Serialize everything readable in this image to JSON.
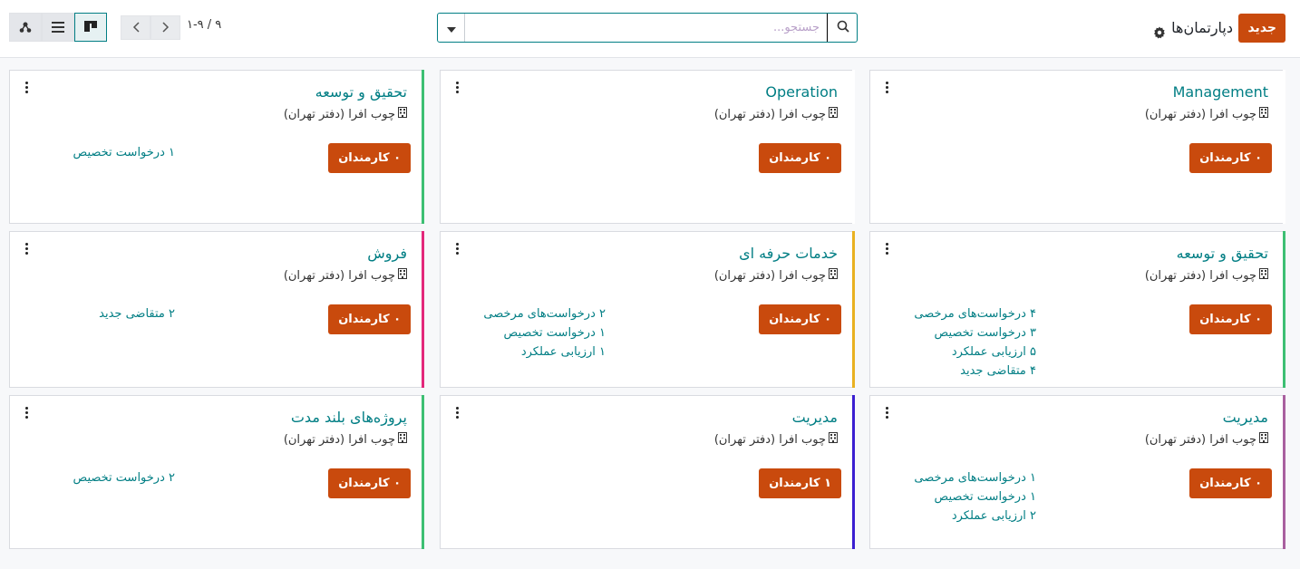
{
  "header": {
    "new_label": "جدید",
    "title": "دپارتمان‌ها",
    "gear_icon": "gear-icon",
    "search_placeholder": "جستجو...",
    "pager": "۱-۹ / ۹"
  },
  "colors": {
    "accent": "#c94a0d",
    "link": "#017e84"
  },
  "cards": [
    {
      "title": "Management",
      "company": "چوب افرا (دفتر تهران)",
      "employees": "۰ کارمندان",
      "stats": [],
      "color": "#ffffff"
    },
    {
      "title": "Operation",
      "company": "چوب افرا (دفتر تهران)",
      "employees": "۰ کارمندان",
      "stats": [],
      "color": "#ffffff"
    },
    {
      "title": "تحقیق و توسعه",
      "company": "چوب افرا (دفتر تهران)",
      "employees": "۰ کارمندان",
      "stats": [
        "۱ درخواست تخصیص"
      ],
      "color": "#3dbf73"
    },
    {
      "title": "تحقیق و توسعه",
      "company": "چوب افرا (دفتر تهران)",
      "employees": "۰ کارمندان",
      "stats": [
        "۴ درخواست‌های مرخصی",
        "۳ درخواست تخصیص",
        "۵ ارزیابی عملکرد",
        "۴ متقاضی جدید"
      ],
      "color": "#3dbf73"
    },
    {
      "title": "خدمات حرفه ای",
      "company": "چوب افرا (دفتر تهران)",
      "employees": "۰ کارمندان",
      "stats": [
        "۲ درخواست‌های مرخصی",
        "۱ درخواست تخصیص",
        "۱ ارزیابی عملکرد"
      ],
      "color": "#e9b121"
    },
    {
      "title": "فروش",
      "company": "چوب افرا (دفتر تهران)",
      "employees": "۰ کارمندان",
      "stats": [
        "۲ متقاضی جدید"
      ],
      "color": "#e3287b"
    },
    {
      "title": "مدیریت",
      "company": "چوب افرا (دفتر تهران)",
      "employees": "۰ کارمندان",
      "stats": [
        "۱ درخواست‌های مرخصی",
        "۱ درخواست تخصیص",
        "۲ ارزیابی عملکرد"
      ],
      "color": "#a9609f"
    },
    {
      "title": "مدیریت",
      "company": "چوب افرا (دفتر تهران)",
      "employees": "۱ کارمندان",
      "stats": [],
      "color": "#3b1fd1"
    },
    {
      "title": "پروژه‌های بلند مدت",
      "company": "چوب افرا (دفتر تهران)",
      "employees": "۰ کارمندان",
      "stats": [
        "۲ درخواست تخصیص"
      ],
      "color": "#3dbf73"
    }
  ]
}
